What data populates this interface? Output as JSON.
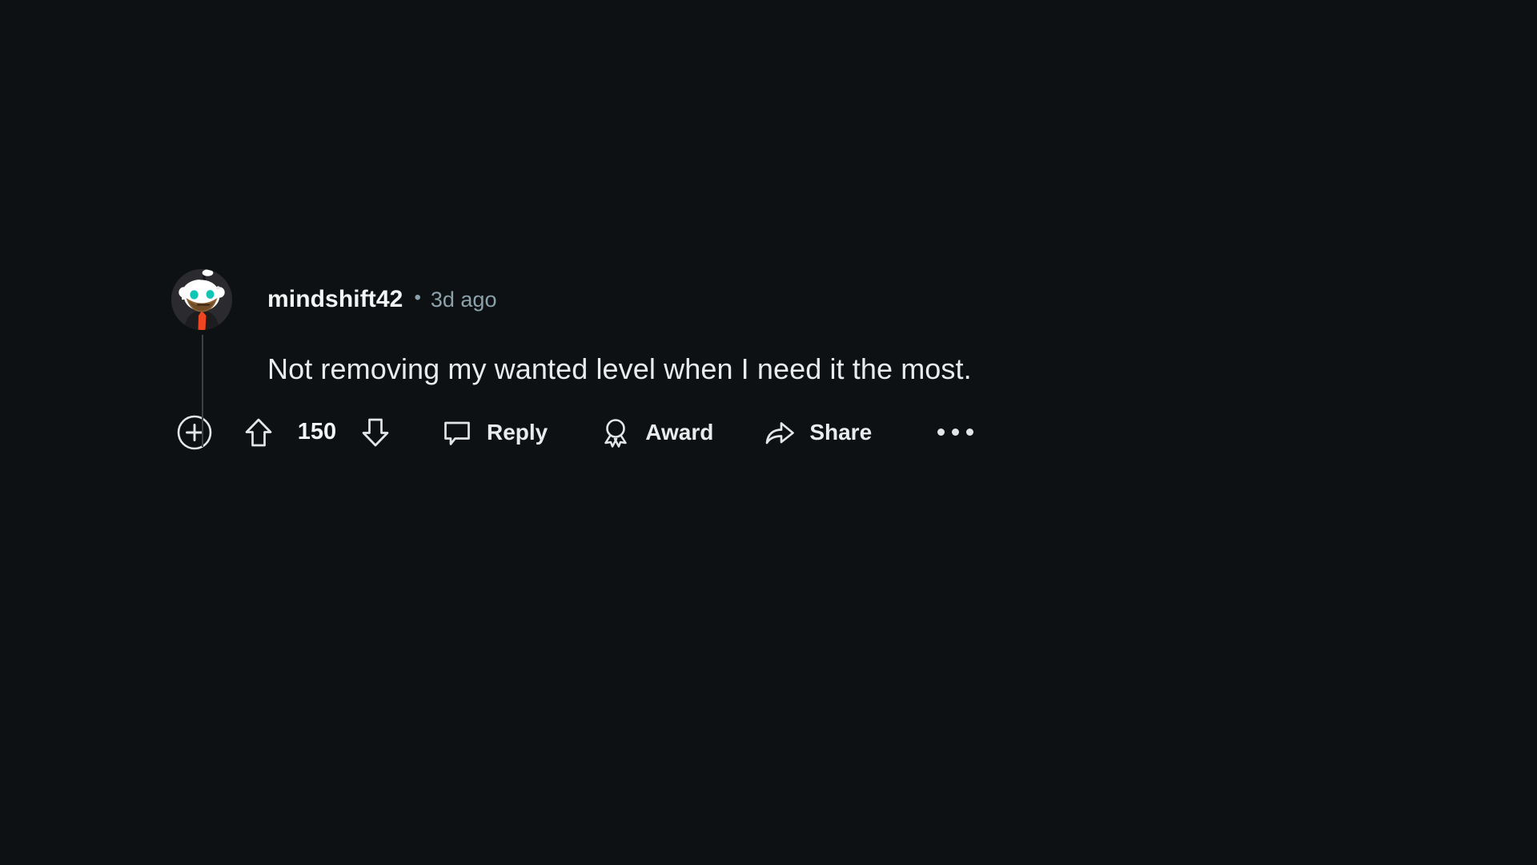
{
  "theme": {
    "background": "#0e1113",
    "text_primary": "#e9ecee",
    "text_secondary": "#8ba2ad",
    "thread_line": "#3c4144",
    "avatar_bg": "#2b2b2f",
    "snoo_white": "#ffffff",
    "snoo_eye": "#12c4b4",
    "snoo_tie": "#ef4621",
    "snoo_jacket": "#1d1d20",
    "snoo_beard": "#8a6134"
  },
  "comment": {
    "author": "mindshift42",
    "separator": "•",
    "timestamp": "3d ago",
    "body": "Not removing my wanted level when I need it the most.",
    "avatar_icon": "reddit-snoo-avatar",
    "collapse_icon": "plus-circle-icon",
    "thread_line": "thread-collapse-line"
  },
  "actions": {
    "upvote": {
      "icon": "upvote-arrow-icon",
      "label": "Upvote"
    },
    "score": "150",
    "downvote": {
      "icon": "downvote-arrow-icon",
      "label": "Downvote"
    },
    "reply": {
      "icon": "comment-bubble-icon",
      "label": "Reply"
    },
    "award": {
      "icon": "award-ribbon-icon",
      "label": "Award"
    },
    "share": {
      "icon": "share-arrow-icon",
      "label": "Share"
    },
    "more": {
      "icon": "more-horizontal-icon",
      "label": "More options"
    }
  }
}
